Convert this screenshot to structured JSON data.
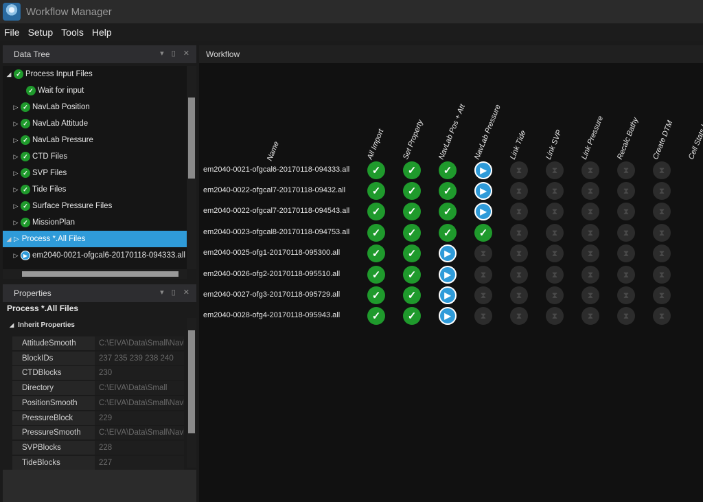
{
  "window": {
    "title": "Workflow Manager"
  },
  "menu": [
    "File",
    "Setup",
    "Tools",
    "Help"
  ],
  "data_tree": {
    "title": "Data Tree",
    "items": [
      {
        "label": "Process Input Files",
        "status": "done",
        "arrow": "◢"
      },
      {
        "label": "Wait for input",
        "status": "done",
        "arrow": ""
      },
      {
        "label": "NavLab Position",
        "status": "done",
        "arrow": "▷"
      },
      {
        "label": "NavLab Attitude",
        "status": "done",
        "arrow": "▷"
      },
      {
        "label": "NavLab Pressure",
        "status": "done",
        "arrow": "▷"
      },
      {
        "label": "CTD Files",
        "status": "done",
        "arrow": "▷"
      },
      {
        "label": "SVP Files",
        "status": "done",
        "arrow": "▷"
      },
      {
        "label": "Tide Files",
        "status": "done",
        "arrow": "▷"
      },
      {
        "label": "Surface Pressure Files",
        "status": "done",
        "arrow": "▷"
      },
      {
        "label": "MissionPlan",
        "status": "done",
        "arrow": "▷"
      },
      {
        "label": "Process *.All Files",
        "status": "run-outline",
        "arrow": "◢"
      },
      {
        "label": "em2040-0021-ofgcal6-20170118-094333.all",
        "status": "run",
        "arrow": "▷"
      }
    ]
  },
  "properties": {
    "title": "Properties",
    "heading": "Process *.All Files",
    "group": "Inherit Properties",
    "rows": [
      {
        "key": "AttitudeSmooth",
        "value": "C:\\EIVA\\Data\\Small\\Navl"
      },
      {
        "key": "BlockIDs",
        "value": "237 235 239 238 240"
      },
      {
        "key": "CTDBlocks",
        "value": "230"
      },
      {
        "key": "Directory",
        "value": "C:\\EIVA\\Data\\Small"
      },
      {
        "key": "PositionSmooth",
        "value": "C:\\EIVA\\Data\\Small\\Navl"
      },
      {
        "key": "PressureBlock",
        "value": "229"
      },
      {
        "key": "PressureSmooth",
        "value": "C:\\EIVA\\Data\\Small\\Navl"
      },
      {
        "key": "SVPBlocks",
        "value": "228"
      },
      {
        "key": "TideBlocks",
        "value": "227"
      }
    ]
  },
  "workflow": {
    "title": "Workflow",
    "name_header": "Name",
    "columns": [
      "All Import",
      "Set Property",
      "NavLab Pos + Att",
      "NavLab Pressure",
      "Link Tide",
      "Link SVP",
      "Link Pressure",
      "Recalc Bathy",
      "Create DTM",
      "Cell Stats before Cl"
    ],
    "rows": [
      {
        "name": "em2040-0021-ofgcal6-20170118-094333.all",
        "status": [
          "done",
          "done",
          "done",
          "run",
          "wait",
          "wait",
          "wait",
          "wait",
          "wait",
          "wait"
        ]
      },
      {
        "name": "em2040-0022-ofgcal7-20170118-09432.all",
        "status": [
          "done",
          "done",
          "done",
          "run",
          "wait",
          "wait",
          "wait",
          "wait",
          "wait",
          "wait"
        ]
      },
      {
        "name": "em2040-0022-ofgcal7-20170118-094543.all",
        "status": [
          "done",
          "done",
          "done",
          "run",
          "wait",
          "wait",
          "wait",
          "wait",
          "wait",
          "wait"
        ]
      },
      {
        "name": "em2040-0023-ofgcal8-20170118-094753.all",
        "status": [
          "done",
          "done",
          "done",
          "done",
          "wait",
          "wait",
          "wait",
          "wait",
          "wait",
          "wait"
        ]
      },
      {
        "name": "em2040-0025-ofg1-20170118-095300.all",
        "status": [
          "done",
          "done",
          "run",
          "wait",
          "wait",
          "wait",
          "wait",
          "wait",
          "wait",
          "wait"
        ]
      },
      {
        "name": "em2040-0026-ofg2-20170118-095510.all",
        "status": [
          "done",
          "done",
          "run",
          "wait",
          "wait",
          "wait",
          "wait",
          "wait",
          "wait",
          "wait"
        ]
      },
      {
        "name": "em2040-0027-ofg3-20170118-095729.all",
        "status": [
          "done",
          "done",
          "run",
          "wait",
          "wait",
          "wait",
          "wait",
          "wait",
          "wait",
          "wait"
        ]
      },
      {
        "name": "em2040-0028-ofg4-20170118-095943.all",
        "status": [
          "done",
          "done",
          "run",
          "wait",
          "wait",
          "wait",
          "wait",
          "wait",
          "wait",
          "wait"
        ]
      }
    ]
  },
  "colors": {
    "done": "#1f9a2c",
    "running": "#2f9bd9",
    "waiting": "#2c2c2c",
    "selection": "#2f9bd9"
  },
  "icons": {
    "done": "check-icon",
    "running": "play-icon",
    "waiting": "hourglass-icon"
  }
}
